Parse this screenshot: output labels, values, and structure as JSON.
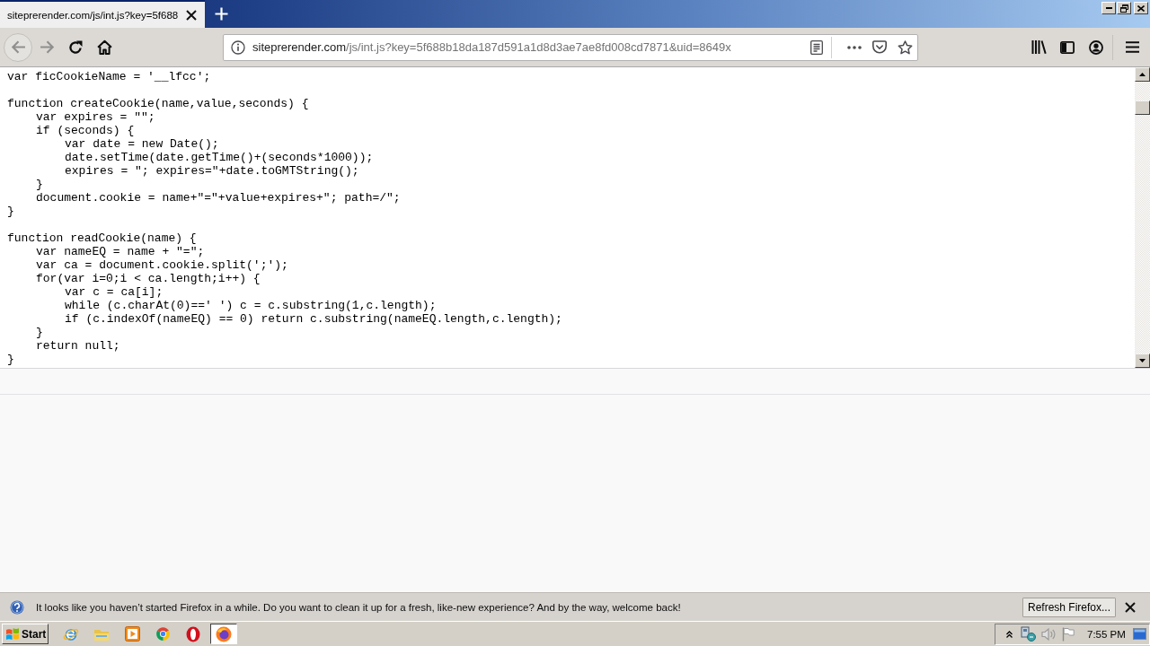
{
  "tabs": [
    {
      "title": "siteprerender.com/js/int.js?key=5f688",
      "selected": true
    }
  ],
  "navigation": [
    {
      "kind": "back",
      "disabled": true
    },
    {
      "kind": "forward",
      "disabled": true
    },
    {
      "kind": "reload",
      "disabled": false
    },
    {
      "kind": "home",
      "disabled": false
    }
  ],
  "address_bar": {
    "domain": "siteprerender.com",
    "path": "/js/int.js?key=5f688b18da187d591a1d8d3ae7ae8fd008cd7871&uid=8649x"
  },
  "code": [
    [
      {
        "text": "var ficCookieName = '__lfcc';"
      }
    ],
    [
      {
        "text": "function createCookie(name,value,seconds) {",
        "children": [
          {
            "text": "var expires = \"\";"
          },
          {
            "text": "if (seconds) {",
            "children": [
              {
                "text": "var date = new Date();"
              },
              {
                "text": "date.setTime(date.getTime()+(seconds*1000));"
              },
              {
                "text": "expires = \"; expires=\"+date.toGMTString();"
              }
            ]
          },
          {
            "text": "}"
          },
          {
            "text": "document.cookie = name+\"=\"+value+expires+\"; path=/\";"
          }
        ]
      },
      {
        "text": "}"
      }
    ],
    [
      {
        "text": "function readCookie(name) {",
        "children": [
          {
            "text": "var nameEQ = name + \"=\";"
          },
          {
            "text": "var ca = document.cookie.split(';');"
          },
          {
            "text": "for(var i=0;i < ca.length;i++) {",
            "children": [
              {
                "text": "var c = ca[i];"
              },
              {
                "text": "while (c.charAt(0)==' ') c = c.substring(1,c.length);"
              },
              {
                "text": "if (c.indexOf(nameEQ) == 0) return c.substring(nameEQ.length,c.length);"
              }
            ]
          },
          {
            "text": "}"
          },
          {
            "text": "return null;"
          }
        ]
      },
      {
        "text": "}"
      }
    ]
  ],
  "notification": {
    "message": "It looks like you haven’t started Firefox in a while. Do you want to clean it up for a fresh, like-new experience? And by the way, welcome back!",
    "button": "Refresh Firefox..."
  },
  "taskbar": {
    "start": "Start",
    "apps": [
      {
        "kind": "globe",
        "selected": false
      },
      {
        "kind": "folder",
        "selected": false
      },
      {
        "kind": "player",
        "selected": false
      },
      {
        "kind": "wheel",
        "selected": false
      },
      {
        "kind": "ring",
        "selected": false
      },
      {
        "kind": "fox",
        "selected": true
      }
    ],
    "clock": "7:55 PM"
  }
}
